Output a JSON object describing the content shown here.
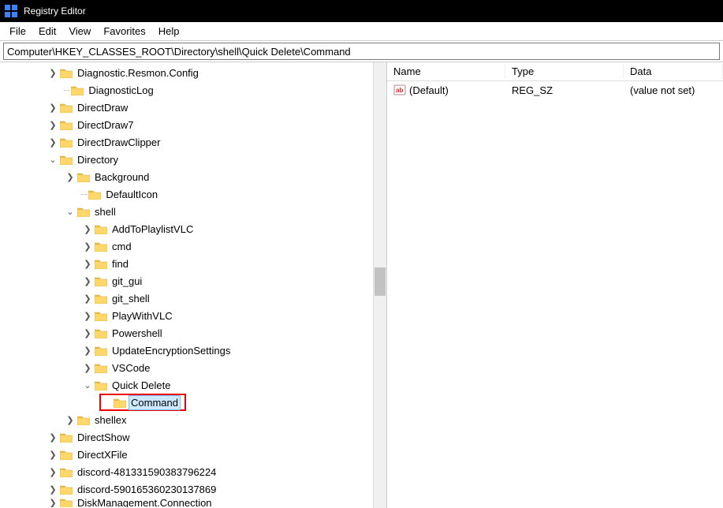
{
  "window": {
    "title": "Registry Editor"
  },
  "menu": {
    "items": [
      "File",
      "Edit",
      "View",
      "Favorites",
      "Help"
    ]
  },
  "address": "Computer\\HKEY_CLASSES_ROOT\\Directory\\shell\\Quick Delete\\Command",
  "list": {
    "headers": {
      "name": "Name",
      "type": "Type",
      "data": "Data"
    },
    "rows": [
      {
        "name": "(Default)",
        "type": "REG_SZ",
        "data": "(value not set)"
      }
    ]
  },
  "tree": [
    {
      "indent": 2,
      "exp": ">",
      "label": "Diagnostic.Resmon.Config"
    },
    {
      "indent": 2,
      "exp": "",
      "label": "DiagnosticLog",
      "dots": true
    },
    {
      "indent": 2,
      "exp": ">",
      "label": "DirectDraw"
    },
    {
      "indent": 2,
      "exp": ">",
      "label": "DirectDraw7"
    },
    {
      "indent": 2,
      "exp": ">",
      "label": "DirectDrawClipper"
    },
    {
      "indent": 2,
      "exp": "v",
      "label": "Directory"
    },
    {
      "indent": 3,
      "exp": ">",
      "label": "Background"
    },
    {
      "indent": 3,
      "exp": "",
      "label": "DefaultIcon",
      "dots": true
    },
    {
      "indent": 3,
      "exp": "v",
      "label": "shell"
    },
    {
      "indent": 4,
      "exp": ">",
      "label": "AddToPlaylistVLC"
    },
    {
      "indent": 4,
      "exp": ">",
      "label": "cmd"
    },
    {
      "indent": 4,
      "exp": ">",
      "label": "find"
    },
    {
      "indent": 4,
      "exp": ">",
      "label": "git_gui"
    },
    {
      "indent": 4,
      "exp": ">",
      "label": "git_shell"
    },
    {
      "indent": 4,
      "exp": ">",
      "label": "PlayWithVLC"
    },
    {
      "indent": 4,
      "exp": ">",
      "label": "Powershell"
    },
    {
      "indent": 4,
      "exp": ">",
      "label": "UpdateEncryptionSettings"
    },
    {
      "indent": 4,
      "exp": ">",
      "label": "VSCode"
    },
    {
      "indent": 4,
      "exp": "v",
      "label": "Quick Delete"
    },
    {
      "indent": 5,
      "exp": "",
      "label": "Command",
      "selected": true,
      "highlight": true
    },
    {
      "indent": 3,
      "exp": ">",
      "label": "shellex"
    },
    {
      "indent": 2,
      "exp": ">",
      "label": "DirectShow"
    },
    {
      "indent": 2,
      "exp": ">",
      "label": "DirectXFile"
    },
    {
      "indent": 2,
      "exp": ">",
      "label": "discord-481331590383796224"
    },
    {
      "indent": 2,
      "exp": ">",
      "label": "discord-590165360230137869"
    },
    {
      "indent": 2,
      "exp": ">",
      "label": "DiskManagement.Connection",
      "cut": true
    }
  ]
}
